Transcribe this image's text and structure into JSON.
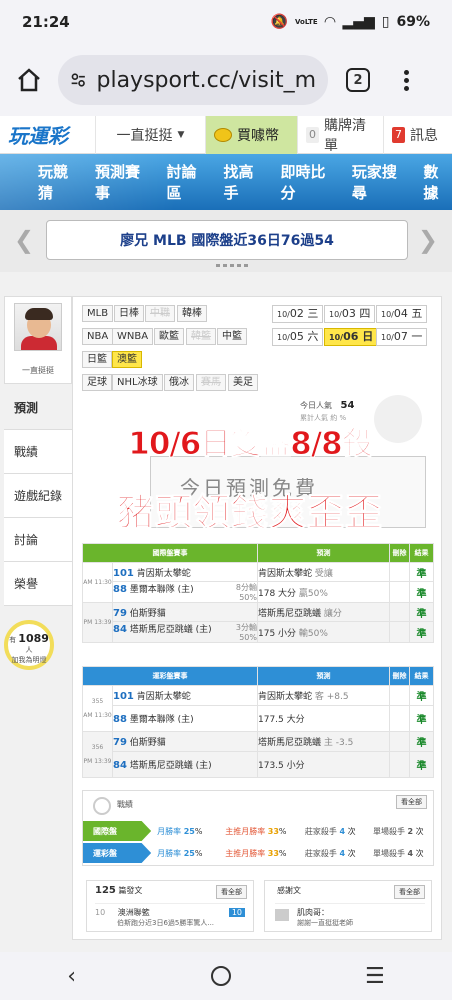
{
  "status": {
    "time": "21:24",
    "battery": "69%",
    "net": "VoLTE"
  },
  "browser": {
    "url": "playsport.cc/visit_m",
    "tab_count": "2"
  },
  "site": {
    "logo": "玩運彩",
    "menu_label": "一直挺挺",
    "buy_label": "買噱幣",
    "cart_count": "0",
    "cart_label": "購牌清單",
    "msg_count": "7",
    "msg_label": "訊息"
  },
  "nav": [
    "玩競猜",
    "預測賽事",
    "討論區",
    "找高手",
    "即時比分",
    "玩家搜尋",
    "數據"
  ],
  "ticker": {
    "text": "廖兄 MLB 國際盤近36日76過54"
  },
  "sidebar": {
    "name": "一直挺挺",
    "items": [
      "預測",
      "戰績",
      "遊戲紀錄",
      "討論",
      "榮譽"
    ],
    "fans_prefix": "有",
    "fans_count": "1089",
    "fans_suffix": "人",
    "fans_line2": "加我為明燈"
  },
  "leagues": [
    [
      "MLB",
      "日棒",
      "中職",
      "韓棒"
    ],
    [
      "NBA",
      "WNBA",
      "歐籃",
      "韓籃",
      "中籃"
    ],
    [
      "日籃",
      "澳籃"
    ],
    [
      "足球",
      "NHL冰球",
      "俄冰",
      "賽馬",
      "美足"
    ]
  ],
  "dates": [
    {
      "d": "10/",
      "n": "02",
      "w": "三"
    },
    {
      "d": "10/",
      "n": "03",
      "w": "四"
    },
    {
      "d": "10/",
      "n": "04",
      "w": "五"
    },
    {
      "d": "10/",
      "n": "05",
      "w": "六"
    },
    {
      "d": "10/",
      "n": "06",
      "w": "日"
    },
    {
      "d": "10/",
      "n": "07",
      "w": "一"
    }
  ],
  "today": {
    "label": "今日人氣",
    "count": "54",
    "sub": "累計人氣 約 %"
  },
  "overlay": {
    "line1": "10/6日雙盤8/8殺",
    "line2": "豬頭領錢爽歪歪"
  },
  "watermark": "今日預測免費",
  "intl": {
    "headers": [
      "國際盤賽事",
      "預測",
      "刪除",
      "結果"
    ],
    "games": [
      {
        "time": "AM 11:30",
        "n1": "101",
        "t1": "肯因斯太攀蛇",
        "n2": "88",
        "t2": "墨爾本聯隊 (主)",
        "s1": "8分輸",
        "s2": "50%",
        "p1": "肯因斯太攀蛇",
        "p1b": "受讓",
        "p2": "178 大分",
        "p2b": "贏50%",
        "r1": "準",
        "r2": "準"
      },
      {
        "time": "PM 13:39",
        "n1": "79",
        "t1": "伯斯野貓",
        "n2": "84",
        "t2": "塔斯馬尼亞跳蟻 (主)",
        "s1": "3分輸",
        "s2": "50%",
        "p1": "塔斯馬尼亞跳蟻",
        "p1b": "讓分",
        "p2": "175 小分",
        "p2b": "輸50%",
        "r1": "準",
        "r2": "準"
      }
    ]
  },
  "local": {
    "headers": [
      "運彩盤賽事",
      "預測",
      "刪除",
      "結果"
    ],
    "games": [
      {
        "code": "355",
        "time": "AM 11:30",
        "n1": "101",
        "t1": "肯因斯太攀蛇",
        "n2": "88",
        "t2": "墨爾本聯隊 (主)",
        "p1": "肯因斯太攀蛇",
        "p1b": "客 +8.5",
        "p2": "177.5 大分",
        "r1": "準",
        "r2": "準"
      },
      {
        "code": "356",
        "time": "PM 13:39",
        "n1": "79",
        "t1": "伯斯野貓",
        "n2": "84",
        "t2": "塔斯馬尼亞跳蟻 (主)",
        "p1": "塔斯馬尼亞跳蟻",
        "p1b": "主 -3.5",
        "p2": "173.5 小分",
        "r1": "準",
        "r2": "準"
      }
    ]
  },
  "stats": {
    "title": "戰績",
    "more": "看全部",
    "rows": [
      {
        "label": "國際盤",
        "a": "月勝率",
        "av": "25",
        "b": "主推月勝率",
        "bv": "33",
        "c": "莊家殺手",
        "cv": "4",
        "d": "單場殺手",
        "dv": "2"
      },
      {
        "label": "運彩盤",
        "a": "月勝率",
        "av": "25",
        "b": "主推月勝率",
        "bv": "33",
        "c": "莊家殺手",
        "cv": "4",
        "d": "單場殺手",
        "dv": "4"
      }
    ]
  },
  "bottom": {
    "left_count": "125",
    "left_title": "篇發文",
    "left_more": "看全部",
    "left_item_num": "10",
    "left_item_title": "澳洲聯籃",
    "left_item_sub": "伯斯跑分近3日6過5勝率驚人...",
    "left_item_badge": "10",
    "right_title": "感謝文",
    "right_more": "看全部",
    "right_item_title": "肌肉哥：",
    "right_item_sub": "謝謝一直挺挺老師"
  },
  "colors": {
    "intl_header": "#6ab52c",
    "local_header": "#2e8fd6",
    "accent_yellow": "#ffe64a",
    "overlay_red": "#e1181c",
    "nav_blue": "#1a6fb8"
  }
}
